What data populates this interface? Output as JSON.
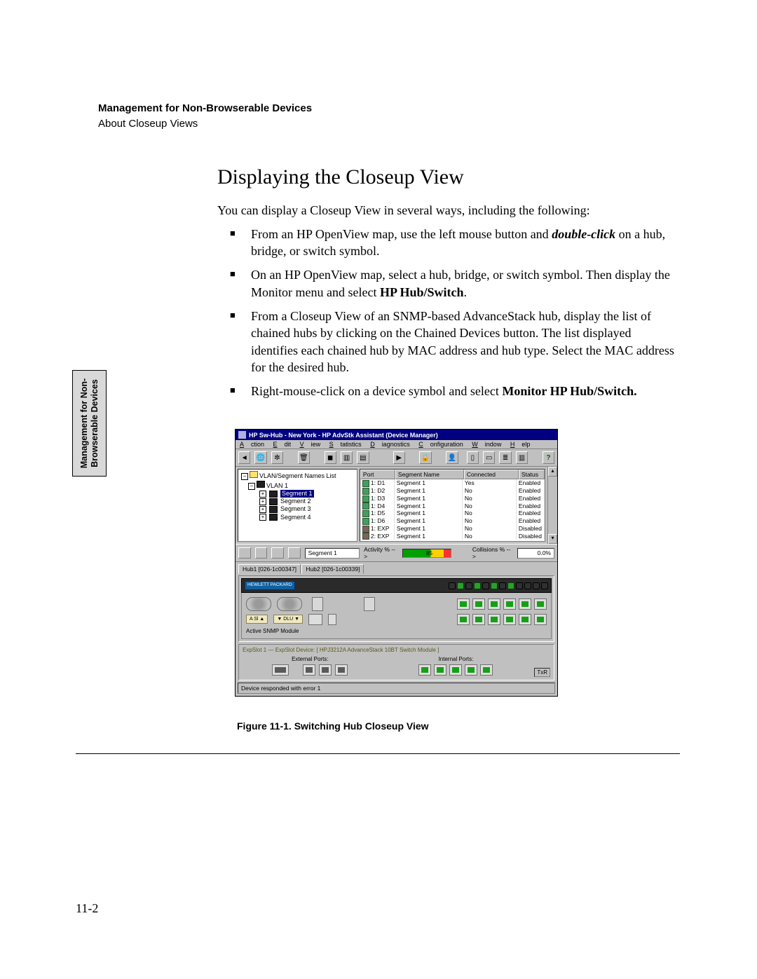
{
  "header": {
    "bold": "Management for Non-Browserable Devices",
    "regular": "About Closeup Views"
  },
  "sideTab": "Management for Non-Browserable Devices",
  "section": {
    "title": "Displaying the Closeup View",
    "intro": "You can display a Closeup View in several ways, including the following:",
    "bullets": {
      "b1a": "From an HP OpenView map, use the left mouse button and ",
      "b1b": "double-click",
      "b1c": " on a hub, bridge, or switch symbol.",
      "b2a": "On an HP OpenView map, select a hub, bridge, or switch symbol. Then display the Monitor menu and select ",
      "b2b": "HP Hub/Switch",
      "b2c": ".",
      "b3": "From a Closeup View of an SNMP-based AdvanceStack hub, display the list of chained hubs by clicking on the Chained Devices button. The list displayed identifies each chained hub by MAC address and hub type. Select the MAC address for the desired hub.",
      "b4a": "Right-mouse-click on a device symbol and select ",
      "b4b": "Monitor HP Hub/Switch."
    }
  },
  "screenshot": {
    "title": "HP Sw-Hub - New York - HP AdvStk Assistant (Device Manager)",
    "menus": [
      "Action",
      "Edit",
      "View",
      "Statistics",
      "Diagnostics",
      "Configuration",
      "Window",
      "Help"
    ],
    "tree": {
      "root": "VLAN/Segment Names List",
      "vlan": "VLAN 1",
      "items": [
        "Segment 1",
        "Segment 2",
        "Segment 3",
        "Segment 4"
      ]
    },
    "list": {
      "headers": [
        "Port",
        "Segment Name",
        "Connected",
        "Status"
      ],
      "rows": [
        {
          "port": "1: D1",
          "seg": "Segment 1",
          "con": "Yes",
          "stat": "Enabled",
          "on": true
        },
        {
          "port": "1: D2",
          "seg": "Segment 1",
          "con": "No",
          "stat": "Enabled",
          "on": true
        },
        {
          "port": "1: D3",
          "seg": "Segment 1",
          "con": "No",
          "stat": "Enabled",
          "on": true
        },
        {
          "port": "1: D4",
          "seg": "Segment 1",
          "con": "No",
          "stat": "Enabled",
          "on": true
        },
        {
          "port": "1: D5",
          "seg": "Segment 1",
          "con": "No",
          "stat": "Enabled",
          "on": true
        },
        {
          "port": "1: D6",
          "seg": "Segment 1",
          "con": "No",
          "stat": "Enabled",
          "on": true
        },
        {
          "port": "1: EXP",
          "seg": "Segment 1",
          "con": "No",
          "stat": "Disabled",
          "on": false
        },
        {
          "port": "2: EXP",
          "seg": "Segment 1",
          "con": "No",
          "stat": "Disabled",
          "on": false
        }
      ]
    },
    "activity": {
      "segLabel": "Segment 1",
      "actLabel": "Activity % -->",
      "actValue": "85",
      "colLabel": "Collisions % -->",
      "colValue": "0.0%"
    },
    "hubTabs": [
      "Hub1 [026-1c00347]",
      "Hub2 [026-1c00339]"
    ],
    "device": {
      "brand": "HEWLETT PACKARD",
      "activeLabel": "Active SNMP Module",
      "asi": "A Sl ▲",
      "dlu": "▼ DLU ▼"
    },
    "exp": {
      "title": "ExpSlot 1 — ExpSlot Device: [ HPJ3212A AdvanceStack 10BT Switch Module ]",
      "extLabel": "External Ports:",
      "intLabel": "Internal Ports:",
      "txr": "TxR"
    },
    "status": "Device responded with error 1"
  },
  "figure": {
    "caption": "Figure 11-1. Switching Hub Closeup View"
  },
  "pageNumber": "11-2"
}
